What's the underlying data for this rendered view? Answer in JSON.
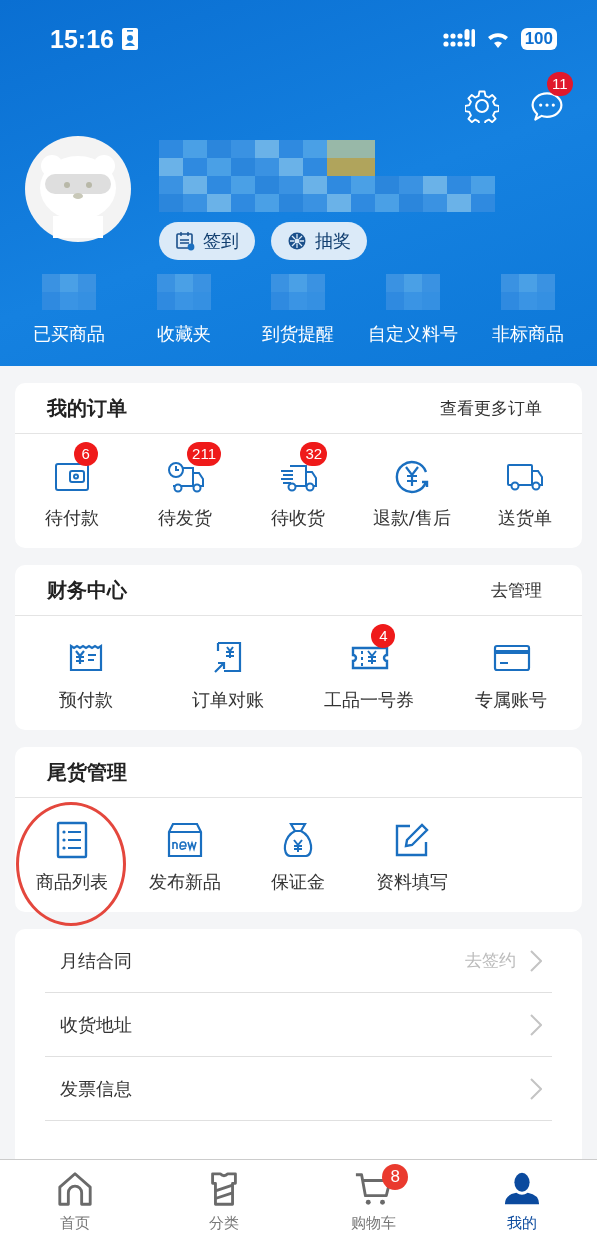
{
  "status_bar": {
    "time": "15:16",
    "battery": "100"
  },
  "header": {
    "message_badge": "11",
    "actions": [
      {
        "label": "签到",
        "kind": "calendar"
      },
      {
        "label": "抽奖",
        "kind": "wheel"
      }
    ],
    "shortcuts": [
      "已买商品",
      "收藏夹",
      "到货提醒",
      "自定义料号",
      "非标商品"
    ]
  },
  "orders": {
    "title": "我的订单",
    "link": "查看更多订单",
    "items": [
      {
        "label": "待付款",
        "kind": "wallet",
        "badge": "6"
      },
      {
        "label": "待发货",
        "kind": "truck-clock",
        "badge": "211"
      },
      {
        "label": "待收货",
        "kind": "truck-fast",
        "badge": "32"
      },
      {
        "label": "退款/售后",
        "kind": "refund"
      },
      {
        "label": "送货单",
        "kind": "truck"
      }
    ]
  },
  "finance": {
    "title": "财务中心",
    "link": "去管理",
    "items": [
      {
        "label": "预付款",
        "kind": "prepay"
      },
      {
        "label": "订单对账",
        "kind": "reconcile"
      },
      {
        "label": "工品一号券",
        "kind": "coupon",
        "badge": "4"
      },
      {
        "label": "专属账号",
        "kind": "card"
      }
    ]
  },
  "clearance": {
    "title": "尾货管理",
    "items": [
      {
        "label": "商品列表",
        "kind": "list",
        "circled": true
      },
      {
        "label": "发布新品",
        "kind": "new",
        "circled": false
      },
      {
        "label": "保证金",
        "kind": "moneybag",
        "circled": false
      },
      {
        "label": "资料填写",
        "kind": "edit",
        "circled": false
      }
    ]
  },
  "menu": [
    {
      "label": "月结合同",
      "hint": "去签约"
    },
    {
      "label": "收货地址"
    },
    {
      "label": "发票信息"
    }
  ],
  "tab_bar": [
    {
      "label": "首页",
      "kind": "home",
      "selected": false
    },
    {
      "label": "分类",
      "kind": "shirt",
      "selected": false
    },
    {
      "label": "购物车",
      "kind": "cart",
      "selected": false,
      "badge": "8"
    },
    {
      "label": "我的",
      "kind": "person",
      "selected": true
    }
  ]
}
